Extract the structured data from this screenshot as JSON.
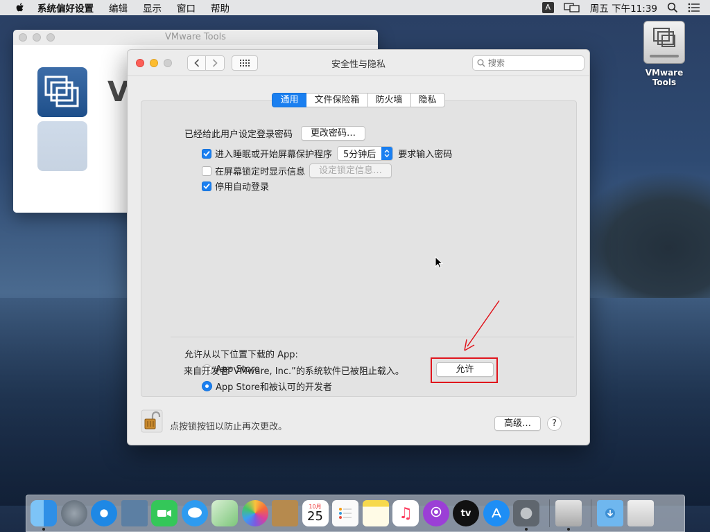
{
  "menubar": {
    "app_name": "系统偏好设置",
    "items": [
      "编辑",
      "显示",
      "窗口",
      "帮助"
    ],
    "ime": "A",
    "clock": "周五 下午11:39"
  },
  "desktop_icon": {
    "label": "VMware Tools"
  },
  "bg_window": {
    "title": "VMware Tools",
    "partial_text": "V"
  },
  "window": {
    "title": "安全性与隐私",
    "search_placeholder": "搜索",
    "tabs": [
      "通用",
      "文件保险箱",
      "防火墙",
      "隐私"
    ],
    "active_tab": "通用"
  },
  "general": {
    "password_label": "已经给此用户设定登录密码",
    "change_password_button": "更改密码…",
    "sleep_checkbox_label": "进入睡眠或开始屏幕保护程序",
    "sleep_checked": true,
    "delay_value": "5分钟后",
    "require_password_label": "要求输入密码",
    "lock_message_label": "在屏幕锁定时显示信息",
    "lock_message_checked": false,
    "lock_message_button": "设定锁定信息…",
    "disable_autologin_label": "停用自动登录",
    "disable_autologin_checked": true,
    "allow_apps_label": "允许从以下位置下载的 App:",
    "radio_appstore": "App Store",
    "radio_identified": "App Store和被认可的开发者",
    "blocked_message": "来自开发者“VMware, Inc.”的系统软件已被阻止载入。",
    "allow_button": "允许"
  },
  "footer": {
    "lock_text": "点按锁按钮以防止再次更改。",
    "advanced_button": "高级…",
    "help_button": "?"
  },
  "colors": {
    "accent": "#1a7ff0",
    "annotation_red": "#e0141c"
  },
  "dock": {
    "apps": [
      {
        "name": "finder-icon",
        "color": "#2f8fe6"
      },
      {
        "name": "launchpad-icon",
        "color": "#6b7886"
      },
      {
        "name": "safari-icon",
        "color": "#1e88e5"
      },
      {
        "name": "photo-preview-icon",
        "color": "#5c7fa3"
      },
      {
        "name": "facetime-icon",
        "color": "#34c759"
      },
      {
        "name": "messages-icon",
        "color": "#2e9bf0"
      },
      {
        "name": "maps-icon",
        "color": "#7cc67a"
      },
      {
        "name": "photos-icon",
        "color": "#f2f2f2"
      },
      {
        "name": "contacts-icon",
        "color": "#b68a4e"
      },
      {
        "name": "calendar-icon",
        "color": "#ffffff",
        "month": "10月",
        "day": "25"
      },
      {
        "name": "reminders-icon",
        "color": "#fafafa"
      },
      {
        "name": "notes-icon",
        "color": "#f7d94c"
      },
      {
        "name": "music-icon",
        "color": "#fc3c5f"
      },
      {
        "name": "podcasts-icon",
        "color": "#9b3fd6"
      },
      {
        "name": "apple-tv-icon",
        "color": "#111111",
        "label": "tv"
      },
      {
        "name": "app-store-icon",
        "color": "#1e8ef5"
      },
      {
        "name": "system-preferences-icon",
        "color": "#7f8790"
      }
    ]
  }
}
